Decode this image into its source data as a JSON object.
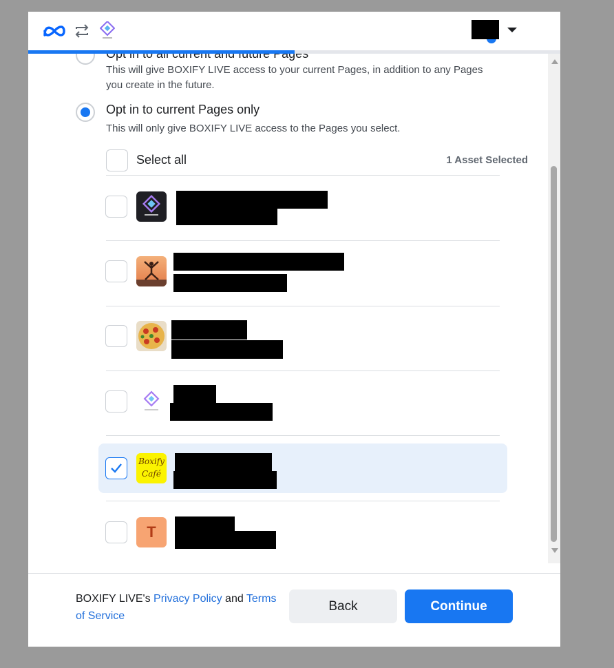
{
  "options": {
    "all_pages": {
      "title": "Opt in to all current and future Pages",
      "description": "This will give BOXIFY LIVE access to your current Pages, in addition to any Pages you create in the future.",
      "selected": false
    },
    "current_pages": {
      "title": "Opt in to current Pages only",
      "description": "This will only give BOXIFY LIVE access to the Pages you select.",
      "selected": true
    }
  },
  "select_all_label": "Select all",
  "asset_count_label": "1 Asset Selected",
  "pages": [
    {
      "avatar": "boxify-dark-logo",
      "checked": false
    },
    {
      "avatar": "yoga-photo",
      "checked": false
    },
    {
      "avatar": "pizza-photo",
      "checked": false
    },
    {
      "avatar": "boxify-light-logo",
      "checked": false
    },
    {
      "avatar": "boxify-cafe-logo",
      "checked": true,
      "avatar_text": "Boxify Café"
    },
    {
      "avatar": "letter-t-avatar",
      "checked": false,
      "avatar_text": "T"
    }
  ],
  "footer": {
    "legal_prefix": "BOXIFY LIVE's ",
    "privacy_policy": "Privacy Policy",
    "and": " and ",
    "terms": "Terms of Service"
  },
  "buttons": {
    "back": "Back",
    "continue": "Continue"
  },
  "progress": 0.5,
  "colors": {
    "accent": "#1877f2",
    "selected_row": "#e7f0fb",
    "link": "#216fdb"
  }
}
